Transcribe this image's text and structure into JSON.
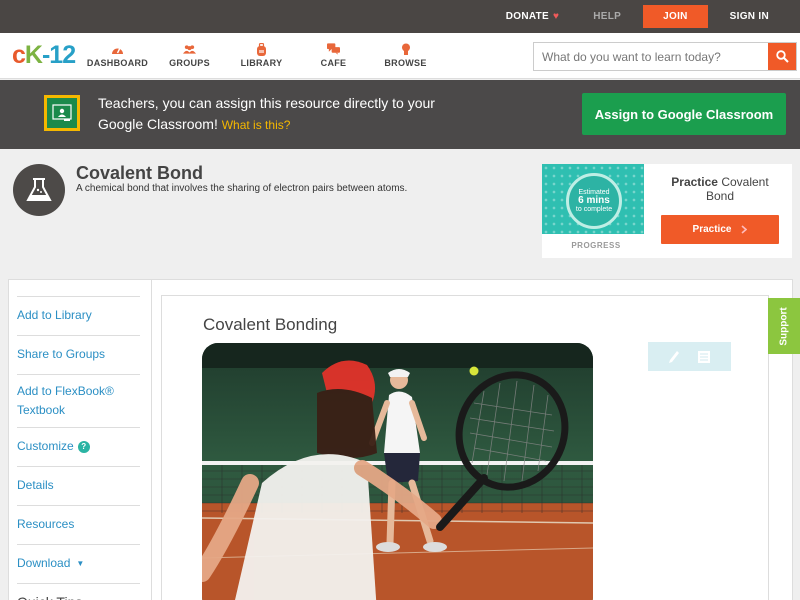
{
  "topbar": {
    "donate": "DONATE",
    "help": "HELP",
    "join": "JOIN",
    "signin": "SIGN IN"
  },
  "nav": {
    "logo": {
      "part1": "c",
      "part2": "K",
      "part3": "-12"
    },
    "items": [
      {
        "label": "DASHBOARD",
        "icon": "gauge-icon"
      },
      {
        "label": "GROUPS",
        "icon": "people-icon"
      },
      {
        "label": "LIBRARY",
        "icon": "backpack-icon"
      },
      {
        "label": "CAFE",
        "icon": "chat-icon"
      },
      {
        "label": "BROWSE",
        "icon": "lightbulb-icon"
      }
    ],
    "search_placeholder": "What do you want to learn today?"
  },
  "google_banner": {
    "text": "Teachers, you can assign this resource directly to your Google Classroom!",
    "what_link": "What is this?",
    "button": "Assign to Google Classroom"
  },
  "concept": {
    "title": "Covalent Bond",
    "description": "A chemical bond that involves the sharing of electron pairs between atoms."
  },
  "practice": {
    "estimate_line1": "Estimated",
    "estimate_line2": "6 mins",
    "estimate_line3": "to complete",
    "progress_label": "PROGRESS",
    "title_bold": "Practice",
    "title_rest": "Covalent Bond",
    "button": "Practice"
  },
  "sidebar": {
    "items": [
      {
        "label": "Add to Library"
      },
      {
        "label": "Share to Groups"
      },
      {
        "label": "Add to FlexBook® Textbook"
      },
      {
        "label": "Customize"
      },
      {
        "label": "Details"
      },
      {
        "label": "Resources"
      },
      {
        "label": "Download"
      },
      {
        "label": "Quick Tips"
      }
    ]
  },
  "content": {
    "title": "Covalent Bonding"
  },
  "support": "Support",
  "colors": {
    "accent": "#f05a28",
    "google_green": "#1b9e4e",
    "link_blue": "#2b8fc4",
    "support_green": "#8cc63f"
  }
}
